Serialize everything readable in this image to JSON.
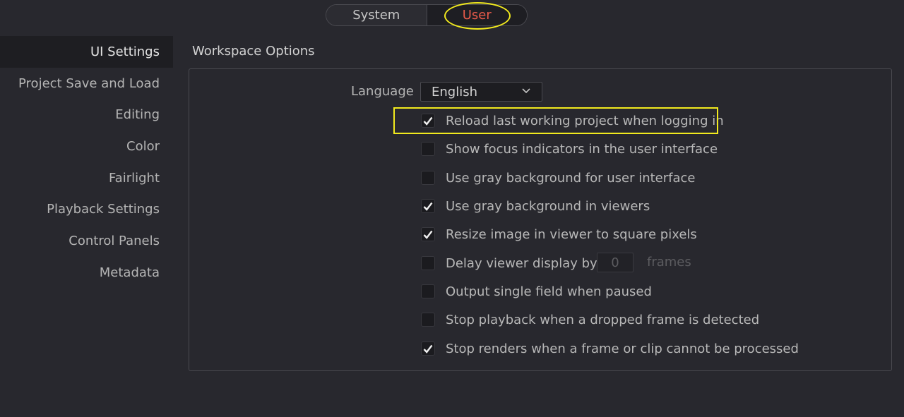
{
  "toggle": {
    "system_label": "System",
    "user_label": "User",
    "selected": "User"
  },
  "sidebar": {
    "items": [
      {
        "label": "UI Settings",
        "active": true
      },
      {
        "label": "Project Save and Load"
      },
      {
        "label": "Editing"
      },
      {
        "label": "Color"
      },
      {
        "label": "Fairlight"
      },
      {
        "label": "Playback Settings"
      },
      {
        "label": "Control Panels"
      },
      {
        "label": "Metadata"
      }
    ]
  },
  "main": {
    "section_title": "Workspace Options",
    "language": {
      "label": "Language",
      "value": "English"
    },
    "options": [
      {
        "label": "Reload last working project when logging in",
        "checked": true
      },
      {
        "label": "Show focus indicators in the user interface",
        "checked": false
      },
      {
        "label": "Use gray background for user interface",
        "checked": false
      },
      {
        "label": "Use gray background in viewers",
        "checked": true
      },
      {
        "label": "Resize image in viewer to square pixels",
        "checked": true
      },
      {
        "label": "Delay viewer display by",
        "checked": false
      },
      {
        "label": "Output single field when paused",
        "checked": false
      },
      {
        "label": "Stop playback when a dropped frame is detected",
        "checked": false
      },
      {
        "label": "Stop renders when a frame or clip cannot be processed",
        "checked": true
      }
    ],
    "delay": {
      "value": "0",
      "unit_label": "frames"
    }
  },
  "colors": {
    "background": "#28282e",
    "active_tab_text": "#e85a4a",
    "annotation_highlight": "#f2ea1e"
  },
  "icons": {
    "dropdown": "chevron-down-icon",
    "check": "checkmark-icon"
  }
}
